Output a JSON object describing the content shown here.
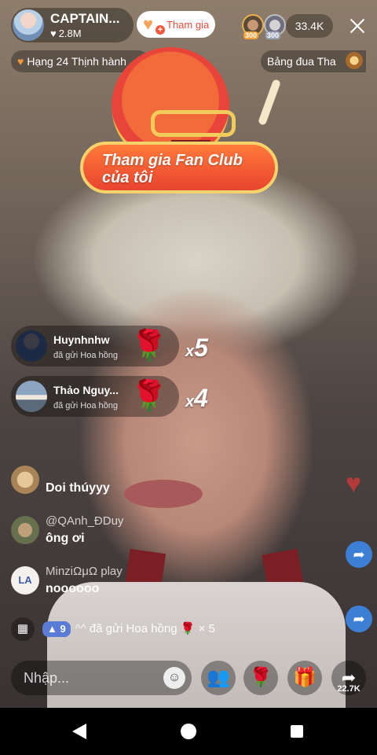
{
  "host": {
    "name": "CAPTAIN...",
    "likes": "2.8M",
    "join_label": "Tham gia"
  },
  "viewers": {
    "badge_1": "300",
    "badge_2": "300",
    "count": "33.4K"
  },
  "rank": {
    "label": "Hạng 24 Thịnh hành"
  },
  "board": {
    "label": "Bảng đua Tha"
  },
  "fan_club": {
    "button_line1": "Tham gia Fan Club",
    "button_line2": "của tôi"
  },
  "gifts": [
    {
      "name": "Huynhnhw",
      "subtitle": "đã gửi Hoa hồng",
      "count": "5"
    },
    {
      "name": "Thảo Nguy...",
      "subtitle": "đã gửi Hoa hồng",
      "count": "4"
    }
  ],
  "chat": [
    {
      "name": "",
      "message": "Doi thúyyy"
    },
    {
      "name": "@QAnh_ĐDuy",
      "message": "ông ơi"
    },
    {
      "name": "MinziΩμΩ play",
      "message": "noooooo",
      "avatar_text": "LA"
    }
  ],
  "gift_line": {
    "level": "9",
    "name": "^^",
    "text": "đã gửi Hoa hồng",
    "multiplier": "× 5"
  },
  "bottom": {
    "input_placeholder": "Nhập...",
    "share_count": "22.7K"
  },
  "colors": {
    "accent_orange": "#ee4d3b",
    "join_heart": "#f6a35b",
    "share_blue": "#3e7fd6"
  },
  "icons": [
    "heart-icon",
    "close-icon",
    "rose-icon",
    "gift-icon",
    "emoji-icon",
    "people-icon",
    "share-icon",
    "back-icon",
    "home-icon",
    "recents-icon"
  ]
}
